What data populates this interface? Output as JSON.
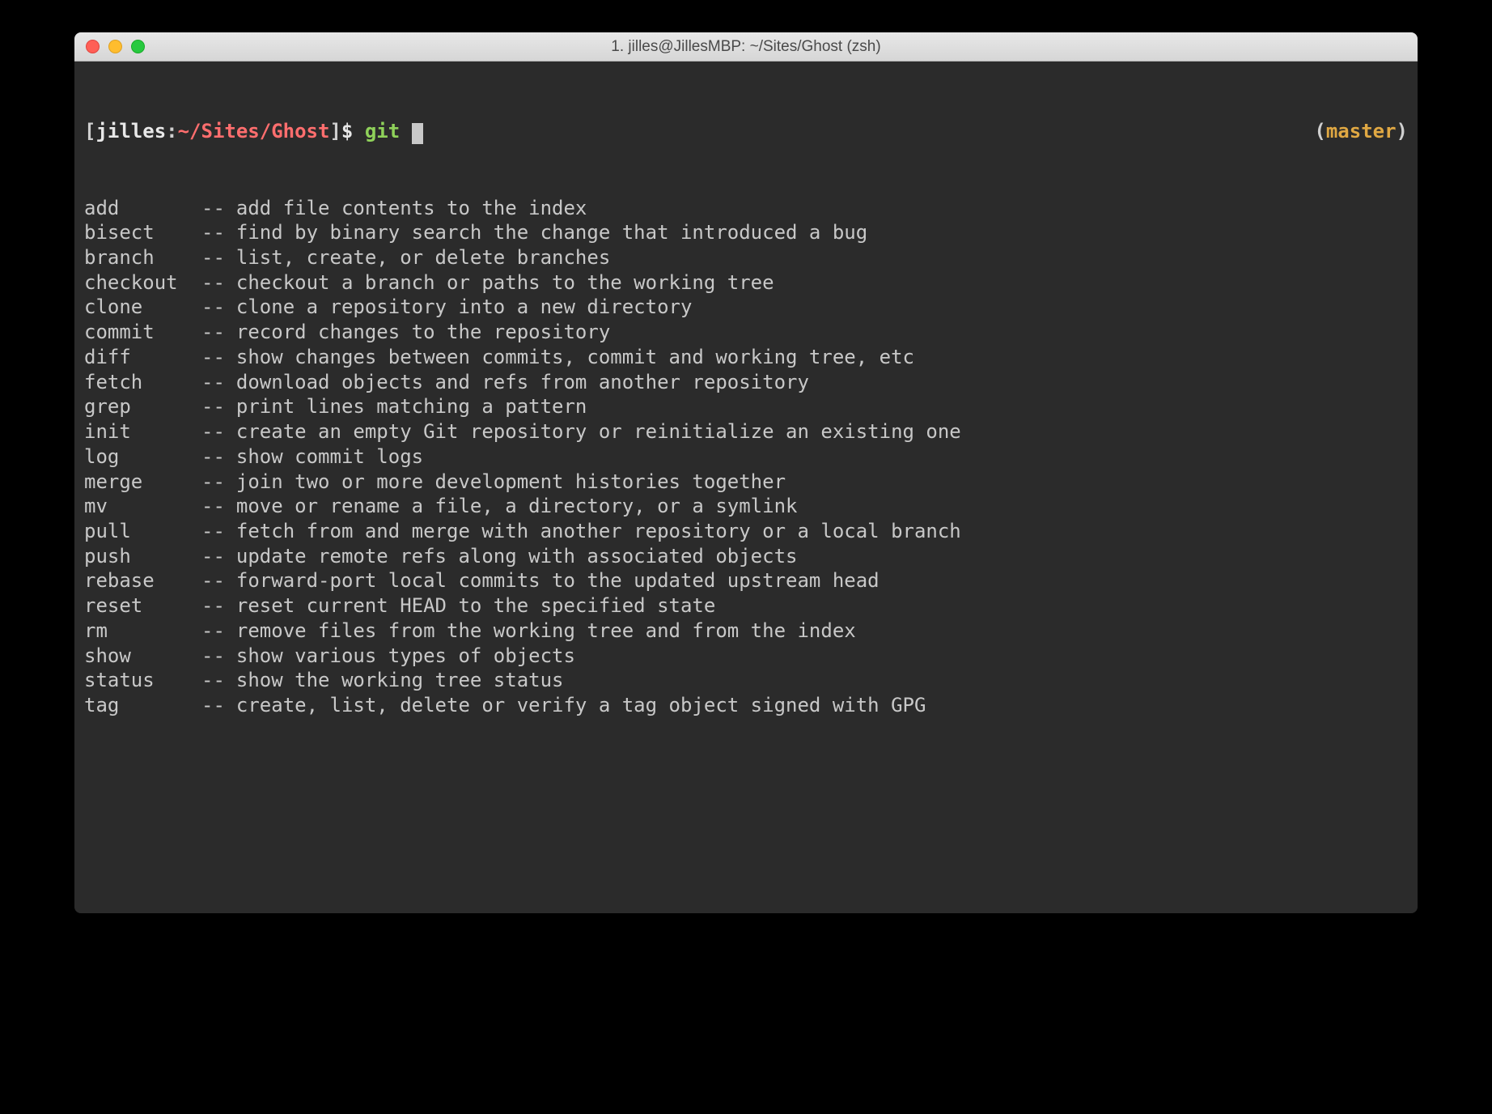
{
  "window": {
    "title": "1. jilles@JillesMBP: ~/Sites/Ghost (zsh)"
  },
  "prompt": {
    "open_bracket": "[",
    "user": "jilles",
    "colon": ":",
    "path": "~/Sites/Ghost",
    "close_bracket": "]",
    "dollar": "$ ",
    "command": "git ",
    "branch_open": "(",
    "branch": "master",
    "branch_close": ")"
  },
  "completions": [
    {
      "cmd": "add",
      "desc": "add file contents to the index"
    },
    {
      "cmd": "bisect",
      "desc": "find by binary search the change that introduced a bug"
    },
    {
      "cmd": "branch",
      "desc": "list, create, or delete branches"
    },
    {
      "cmd": "checkout",
      "desc": "checkout a branch or paths to the working tree"
    },
    {
      "cmd": "clone",
      "desc": "clone a repository into a new directory"
    },
    {
      "cmd": "commit",
      "desc": "record changes to the repository"
    },
    {
      "cmd": "diff",
      "desc": "show changes between commits, commit and working tree, etc"
    },
    {
      "cmd": "fetch",
      "desc": "download objects and refs from another repository"
    },
    {
      "cmd": "grep",
      "desc": "print lines matching a pattern"
    },
    {
      "cmd": "init",
      "desc": "create an empty Git repository or reinitialize an existing one"
    },
    {
      "cmd": "log",
      "desc": "show commit logs"
    },
    {
      "cmd": "merge",
      "desc": "join two or more development histories together"
    },
    {
      "cmd": "mv",
      "desc": "move or rename a file, a directory, or a symlink"
    },
    {
      "cmd": "pull",
      "desc": "fetch from and merge with another repository or a local branch"
    },
    {
      "cmd": "push",
      "desc": "update remote refs along with associated objects"
    },
    {
      "cmd": "rebase",
      "desc": "forward-port local commits to the updated upstream head"
    },
    {
      "cmd": "reset",
      "desc": "reset current HEAD to the specified state"
    },
    {
      "cmd": "rm",
      "desc": "remove files from the working tree and from the index"
    },
    {
      "cmd": "show",
      "desc": "show various types of objects"
    },
    {
      "cmd": "status",
      "desc": "show the working tree status"
    },
    {
      "cmd": "tag",
      "desc": "create, list, delete or verify a tag object signed with GPG"
    }
  ],
  "separator": "--"
}
